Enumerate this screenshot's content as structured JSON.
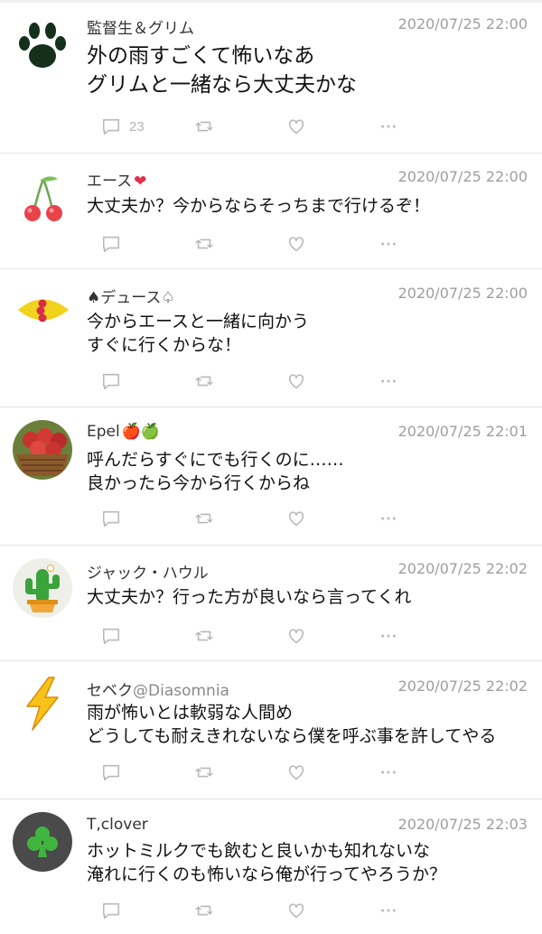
{
  "posts": [
    {
      "name": "監督生＆グリム",
      "handle": "",
      "time": "2020/07/25 22:00",
      "lines": [
        "外の雨すごくて怖いなあ",
        "グリムと一緒なら大丈夫かな"
      ],
      "reply_count": "23",
      "avatar": "paw-print"
    },
    {
      "name": "エース",
      "name_suffix": "❤",
      "handle": "",
      "time": "2020/07/25 22:00",
      "lines": [
        "大丈夫か？今からならそっちまで行けるぞ！"
      ],
      "reply_count": "",
      "avatar": "cherries"
    },
    {
      "name": "♠デュース♤",
      "handle": "",
      "time": "2020/07/25 22:00",
      "lines": [
        "今からエースと一緒に向かう",
        "すぐに行くからな！"
      ],
      "reply_count": "",
      "avatar": "yellow-leaf"
    },
    {
      "name": "Epel",
      "name_suffix": "🍎🍏",
      "handle": "",
      "time": "2020/07/25 22:01",
      "lines": [
        "呼んだらすぐにでも行くのに……",
        "良かったら今から行くからね"
      ],
      "reply_count": "",
      "avatar": "apple-basket"
    },
    {
      "name": "ジャック・ハウル",
      "handle": "",
      "time": "2020/07/25 22:02",
      "lines": [
        "大丈夫か？行った方が良いなら言ってくれ"
      ],
      "reply_count": "",
      "avatar": "cactus"
    },
    {
      "name": "セベク",
      "handle": "@Diasomnia",
      "time": "2020/07/25 22:02",
      "lines": [
        "雨が怖いとは軟弱な人間め",
        "どうしても耐えきれないなら僕を呼ぶ事を許してやる"
      ],
      "reply_count": "",
      "avatar": "lightning"
    },
    {
      "name": "T,clover",
      "handle": "",
      "time": "2020/07/25 22:03",
      "lines": [
        "ホットミルクでも飲むと良いかも知れないな",
        "淹れに行くのも怖いなら俺が行ってやろうか？"
      ],
      "reply_count": "",
      "avatar": "clover"
    }
  ],
  "icons": {
    "reply": "speech-bubble-icon",
    "retweet": "retweet-icon",
    "like": "heart-icon",
    "more": "ellipsis-icon"
  },
  "colors": {
    "icon_gray": "#b8b8b8",
    "time_gray": "#9e9e9e",
    "divider": "#e6e6e6",
    "name_suffix_red": "#e0304a"
  }
}
